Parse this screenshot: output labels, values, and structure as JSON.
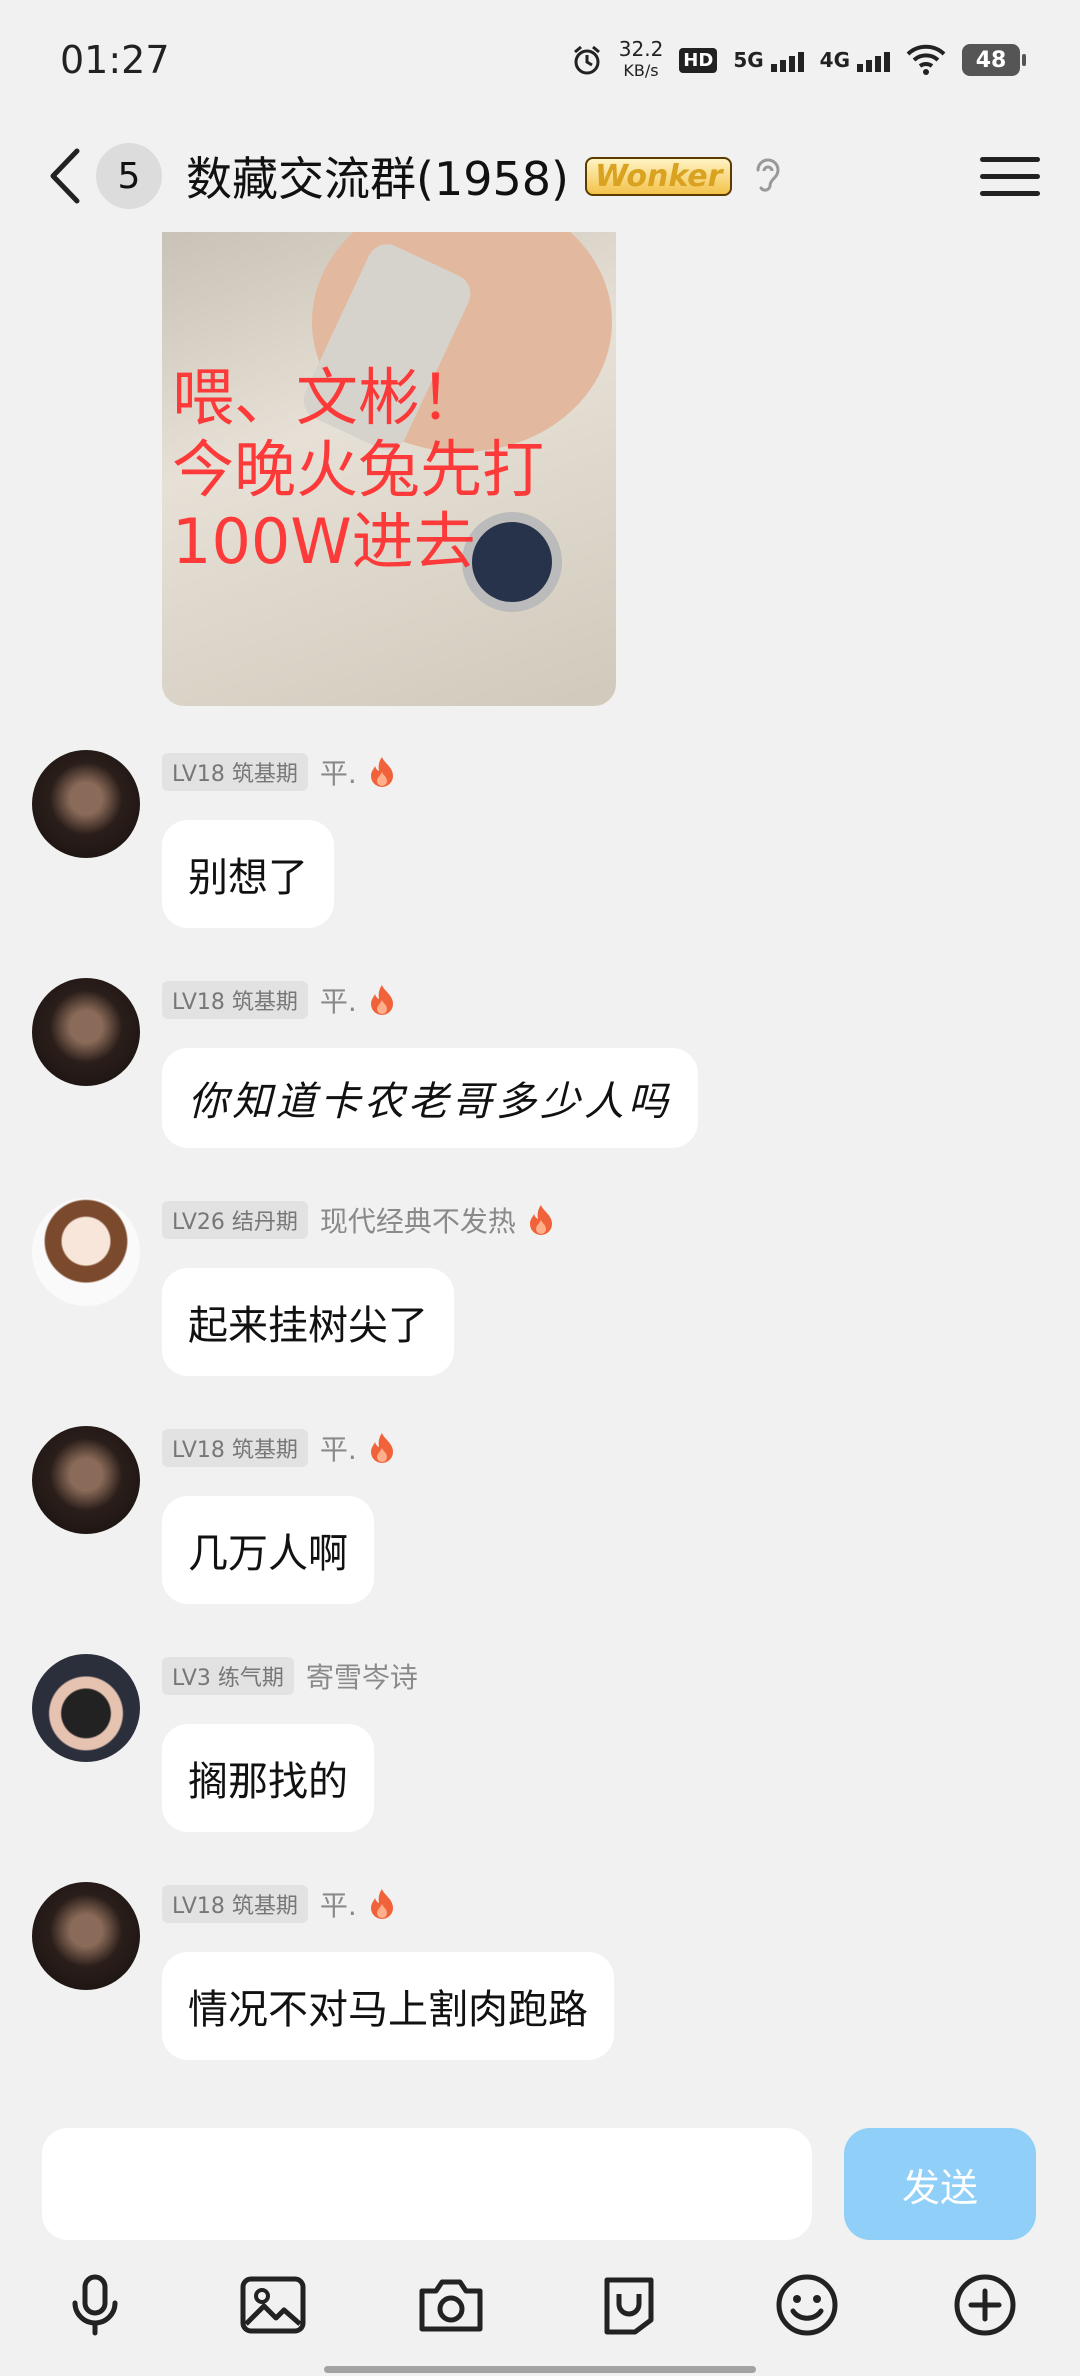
{
  "status_bar": {
    "time": "01:27",
    "net_speed_value": "32.2",
    "net_speed_unit": "KB/s",
    "hd_label": "HD",
    "sig1_label": "5G",
    "sig2_label": "4G",
    "battery": "48"
  },
  "header": {
    "unread_count": "5",
    "title": "数藏交流群(1958)",
    "vip_badge": "Wonker"
  },
  "image_message": {
    "caption": "喂、文彬！\n今晚火兔先打\n100W进去"
  },
  "messages": [
    {
      "level": "LV18 筑基期",
      "nickname": "平.",
      "text": "别想了",
      "has_fire": true,
      "avatar": "dark-portrait"
    },
    {
      "level": "LV18 筑基期",
      "nickname": "平.",
      "text": "你知道卡农老哥多少人吗",
      "has_fire": true,
      "avatar": "dark-portrait"
    },
    {
      "level": "LV26 结丹期",
      "nickname": "现代经典不发热",
      "text": "起来挂树尖了",
      "has_fire": true,
      "avatar": "anime-character"
    },
    {
      "level": "LV18 筑基期",
      "nickname": "平.",
      "text": "几万人啊",
      "has_fire": true,
      "avatar": "dark-portrait"
    },
    {
      "level": "LV3 练气期",
      "nickname": "寄雪岑诗",
      "text": "搁那找的",
      "has_fire": false,
      "avatar": "camera-girl"
    },
    {
      "level": "LV18 筑基期",
      "nickname": "平.",
      "text": "情况不对马上割肉跑路",
      "has_fire": true,
      "avatar": "dark-portrait"
    }
  ],
  "composer": {
    "input_value": "",
    "send_label": "发送"
  },
  "colors": {
    "background": "#f1f1f1",
    "send_button": "#8fcff8",
    "fire": "#f0623a"
  },
  "toolbar_icons": [
    "microphone-icon",
    "image-icon",
    "camera-icon",
    "file-icon",
    "emoji-icon",
    "plus-icon"
  ]
}
